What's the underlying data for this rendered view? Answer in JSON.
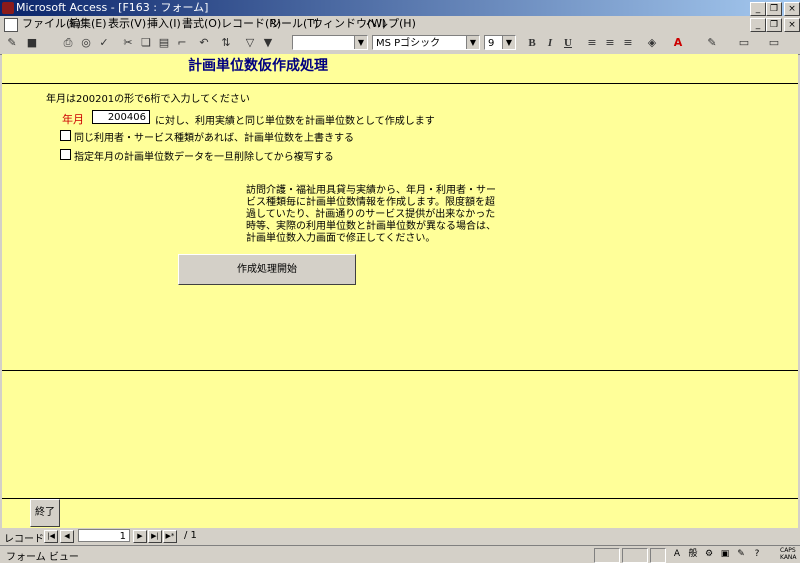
{
  "window": {
    "title": "Microsoft Access - [F163 : フォーム]",
    "min_glyph": "_",
    "restore_glyph": "❐",
    "close_glyph": "×"
  },
  "menu": [
    "ファイル(F)",
    "編集(E)",
    "表示(V)",
    "挿入(I)",
    "書式(O)",
    "レコード(R)",
    "ツール(T)",
    "ウィンドウ(W)",
    "ヘルプ(H)"
  ],
  "toolbar": {
    "font_name": "MS Pゴシック",
    "font_size": "9",
    "bold": "B",
    "italic": "I",
    "underline": "U"
  },
  "form": {
    "title": "計画単位数仮作成処理",
    "instruction": "年月は200201の形で6桁で入力してください",
    "year_month_label": "年月",
    "year_month_value": "200406",
    "year_month_suffix": "に対し、利用実績と同じ単位数を計画単位数として作成します",
    "checkbox_overwrite": "同じ利用者・サービス種類があれば、計画単位数を上書きする",
    "checkbox_delete": "指定年月の計画単位数データを一旦削除してから複写する",
    "note": "訪問介護・福祉用具貸与実績から、年月・利用者・サービス種類毎に計画単位数情報を作成します。限度額を超過していたり、計画通りのサービス提供が出来なかった時等、実際の利用単位数と計画単位数が異なる場合は、計画単位数入力画面で修正してください。",
    "start_button": "作成処理開始",
    "end_button": "終了"
  },
  "record_nav": {
    "label": "レコード:",
    "current": "1",
    "total": "/ 1"
  },
  "status": {
    "text": "フォーム ビュー",
    "caps": "CAPS",
    "kana": "KANA",
    "ime_mode": "般"
  }
}
